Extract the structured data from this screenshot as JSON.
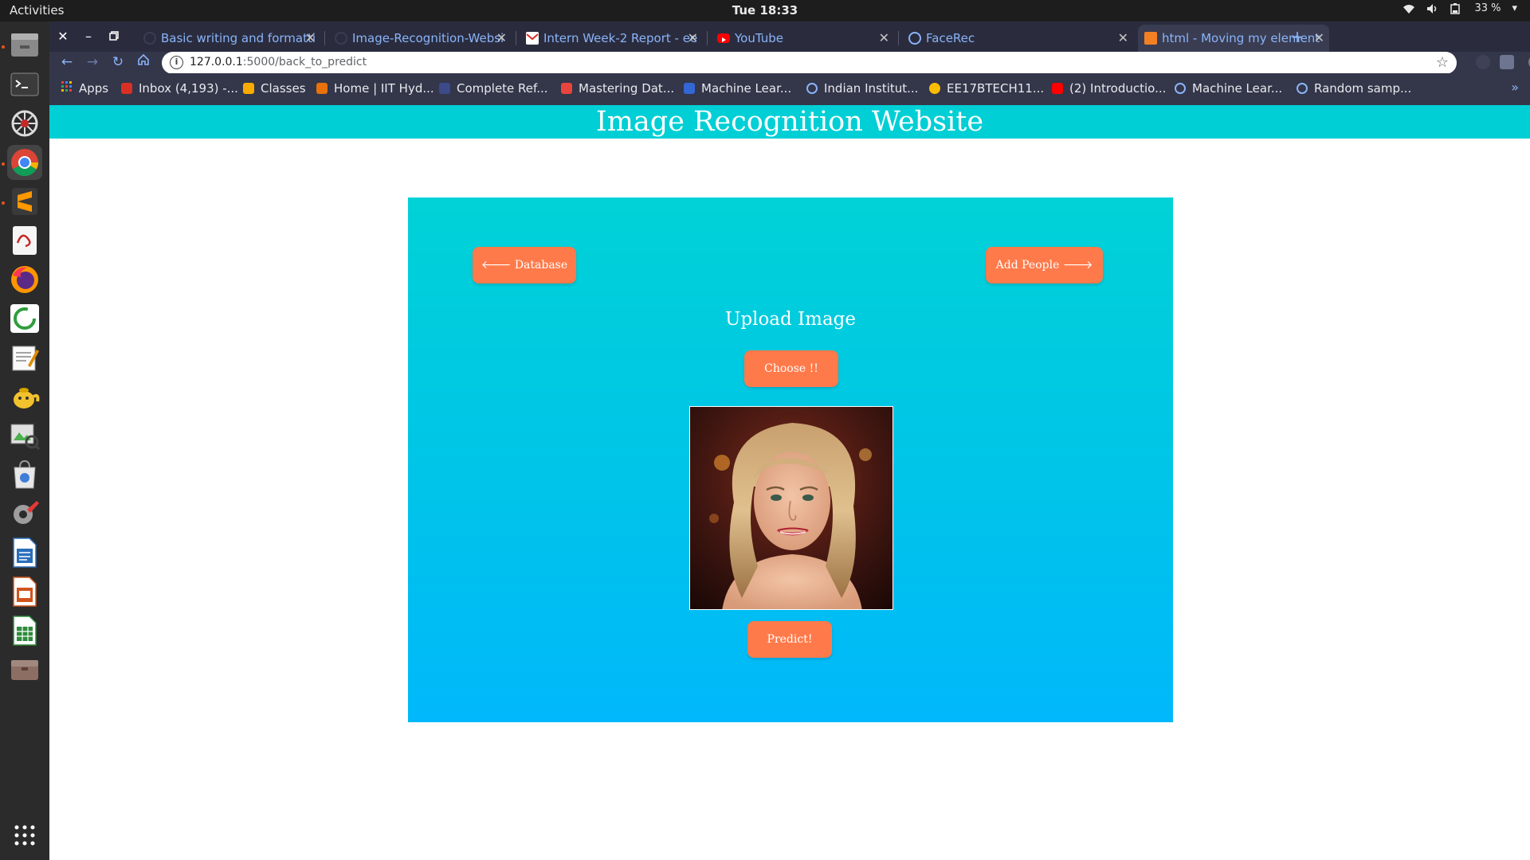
{
  "system": {
    "activities": "Activities",
    "clock": "Tue 18:33",
    "battery": "33 %"
  },
  "browser": {
    "tabs": [
      {
        "title": "Basic writing and formatti",
        "favicon": "github-icon"
      },
      {
        "title": "Image-Recognition-Websi",
        "favicon": "github-icon"
      },
      {
        "title": "Intern Week-2 Report - ee",
        "favicon": "gmail-icon"
      },
      {
        "title": "YouTube",
        "favicon": "youtube-icon"
      },
      {
        "title": "FaceRec",
        "favicon": "globe-icon"
      },
      {
        "title": "html - Moving my element",
        "favicon": "stackoverflow-icon"
      }
    ],
    "url_host": "127.0.0.1",
    "url_path": ":5000/back_to_predict",
    "bookmarks": [
      {
        "label": "Apps",
        "icon": "apps-grid-icon",
        "color": "#ea4335"
      },
      {
        "label": "Inbox (4,193) -...",
        "icon": "gmail-icon",
        "color": "#d93025"
      },
      {
        "label": "Classes",
        "icon": "classroom-icon",
        "color": "#f9ab00"
      },
      {
        "label": "Home | IIT Hyd...",
        "icon": "iith-icon",
        "color": "#e8710a"
      },
      {
        "label": "Complete Ref...",
        "icon": "bookmark-icon",
        "color": "#3c4a8a"
      },
      {
        "label": "Mastering Dat...",
        "icon": "coursera-icon",
        "color": "#e8453c"
      },
      {
        "label": "Machine Lear...",
        "icon": "s-icon",
        "color": "#3367d6"
      },
      {
        "label": "Indian Institut...",
        "icon": "nptel-icon",
        "color": "#8ab4f8"
      },
      {
        "label": "EE17BTECH11...",
        "icon": "smiley-icon",
        "color": "#fbbc04"
      },
      {
        "label": "(2) Introductio...",
        "icon": "youtube-icon",
        "color": "#ff0000"
      },
      {
        "label": "Machine Lear...",
        "icon": "nptel-icon",
        "color": "#8ab4f8"
      },
      {
        "label": "Random samp...",
        "icon": "settings-icon",
        "color": "#8ab4f8"
      }
    ]
  },
  "site": {
    "title": "Image Recognition Website",
    "database_button": "Database",
    "add_people_button": "Add People",
    "upload_title": "Upload Image",
    "choose_button": "Choose !!",
    "predict_button": "Predict!"
  },
  "colors": {
    "header": "#00cfd5",
    "button": "#ff7a4a",
    "panel_top": "#00d2d6",
    "panel_bottom": "#00b8fb"
  }
}
